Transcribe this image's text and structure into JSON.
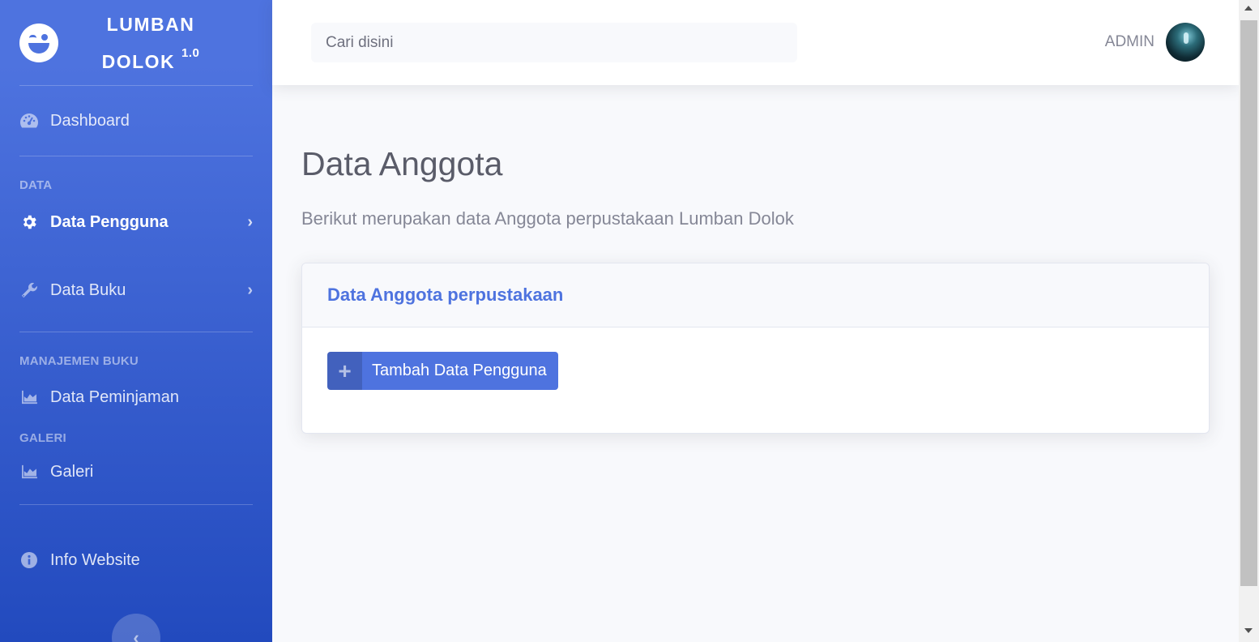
{
  "sidebar": {
    "brand_line1": "LUMBAN",
    "brand_line2": "DOLOK",
    "brand_version": "1.0",
    "brand_icon": "grin-wink-icon",
    "items": [
      {
        "label": "Dashboard",
        "icon": "tachometer-icon"
      },
      {
        "label": "Data Pengguna",
        "icon": "cog-icon",
        "active": true
      },
      {
        "label": "Data Buku",
        "icon": "wrench-icon"
      },
      {
        "label": "Data Peminjaman",
        "icon": "chart-area-icon"
      },
      {
        "label": "Galeri",
        "icon": "chart-area-icon"
      },
      {
        "label": "Info Website",
        "icon": "info-circle-icon"
      }
    ],
    "headings": [
      "DATA",
      "MANAJEMEN BUKU",
      "GALERI"
    ],
    "toggle_glyph": "‹"
  },
  "topbar": {
    "search_placeholder": "Cari disini",
    "user_name": "ADMIN"
  },
  "main": {
    "title": "Data Anggota",
    "subtitle": "Berikut merupakan data Anggota perpustakaan Lumban Dolok",
    "card_title": "Data Anggota perpustakaan",
    "add_button_icon": "+",
    "add_button_label": "Tambah Data Pengguna"
  },
  "colors": {
    "primary": "#4e73df",
    "sidebar_gradient_end": "#224abe",
    "background": "#f8f9fc",
    "text_muted": "#858796"
  }
}
